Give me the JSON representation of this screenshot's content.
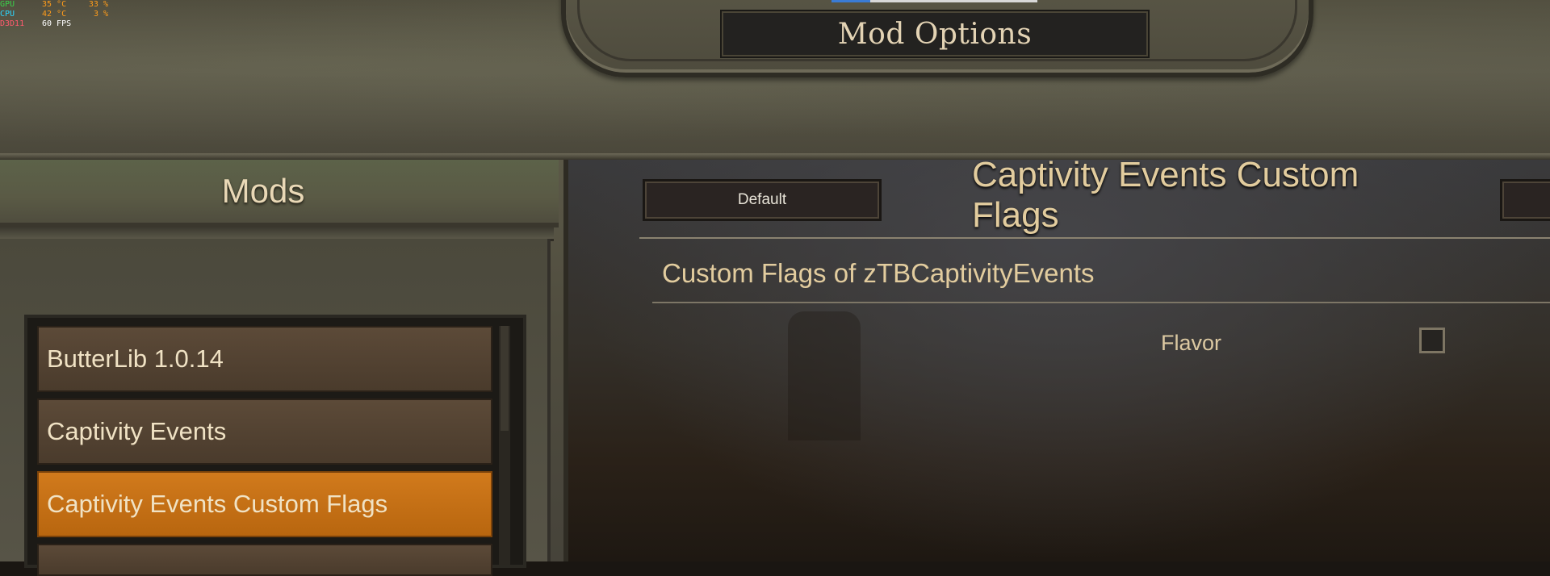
{
  "perf_overlay": {
    "rows": [
      {
        "label": "GPU",
        "v1": "35 °C",
        "v2": "33 %",
        "label_color": "#3ad14a"
      },
      {
        "label": "CPU",
        "v1": "42 °C",
        "v2": "3 %",
        "label_color": "#2bd7ff"
      },
      {
        "label": "D3D11",
        "v1": "60 FPS",
        "v2": "",
        "label_color": "#ff5a6e"
      }
    ]
  },
  "header": {
    "title": "Mod Options"
  },
  "left_panel": {
    "title": "Mods",
    "mods": [
      {
        "label": "ButterLib 1.0.14",
        "selected": false
      },
      {
        "label": "Captivity Events",
        "selected": false
      },
      {
        "label": "Captivity Events Custom Flags",
        "selected": true
      }
    ]
  },
  "right_panel": {
    "default_button": "Default",
    "title": "Captivity Events Custom Flags",
    "group_title": "Custom Flags of zTBCaptivityEvents",
    "settings": [
      {
        "label": "Flavor",
        "checked": false
      }
    ]
  },
  "colors": {
    "accent_selected": "#d17a1c",
    "title_text": "#e2cc9e",
    "panel_bg": "#1c1a16"
  }
}
